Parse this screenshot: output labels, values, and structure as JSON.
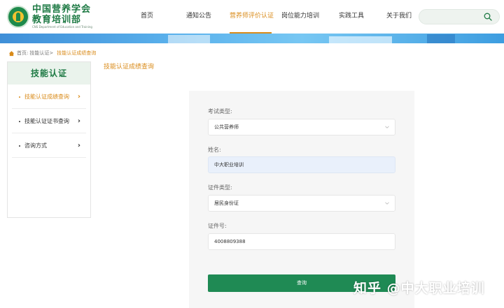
{
  "header": {
    "logo_line1": "中国营养学会",
    "logo_line2": "教育培训部",
    "logo_line3": "CNS Department of Education and Training"
  },
  "nav": {
    "items": [
      {
        "label": "首页",
        "active": false
      },
      {
        "label": "通知公告",
        "active": false
      },
      {
        "label": "营养师评价认证",
        "active": true
      },
      {
        "label": "岗位能力培训",
        "active": false
      },
      {
        "label": "实践工具",
        "active": false
      },
      {
        "label": "关于我们",
        "active": false
      }
    ]
  },
  "search": {
    "placeholder": ""
  },
  "breadcrumb": {
    "home": "首页:",
    "level1": "技能认证>",
    "current": "技能认证成绩查询"
  },
  "sidebar": {
    "title": "技能认证",
    "items": [
      {
        "label": "技能认证成绩查询",
        "active": true
      },
      {
        "label": "技能认证证书查询",
        "active": false
      },
      {
        "label": "咨询方式",
        "active": false
      }
    ]
  },
  "section_title": "技能认证成绩查询",
  "form": {
    "exam_type_label": "考试类型:",
    "exam_type_value": "公共营养师",
    "name_label": "姓名:",
    "name_value": "中大职业培训",
    "id_type_label": "证件类型:",
    "id_type_value": "居民身份证",
    "id_no_label": "证件号:",
    "id_no_value": "4008809388",
    "submit_label": "查询"
  },
  "watermark": "知乎 @中大职业培训",
  "colors": {
    "brand_green": "#1e7a44",
    "accent_orange": "#d98b1a",
    "button_green": "#1f8a54"
  }
}
